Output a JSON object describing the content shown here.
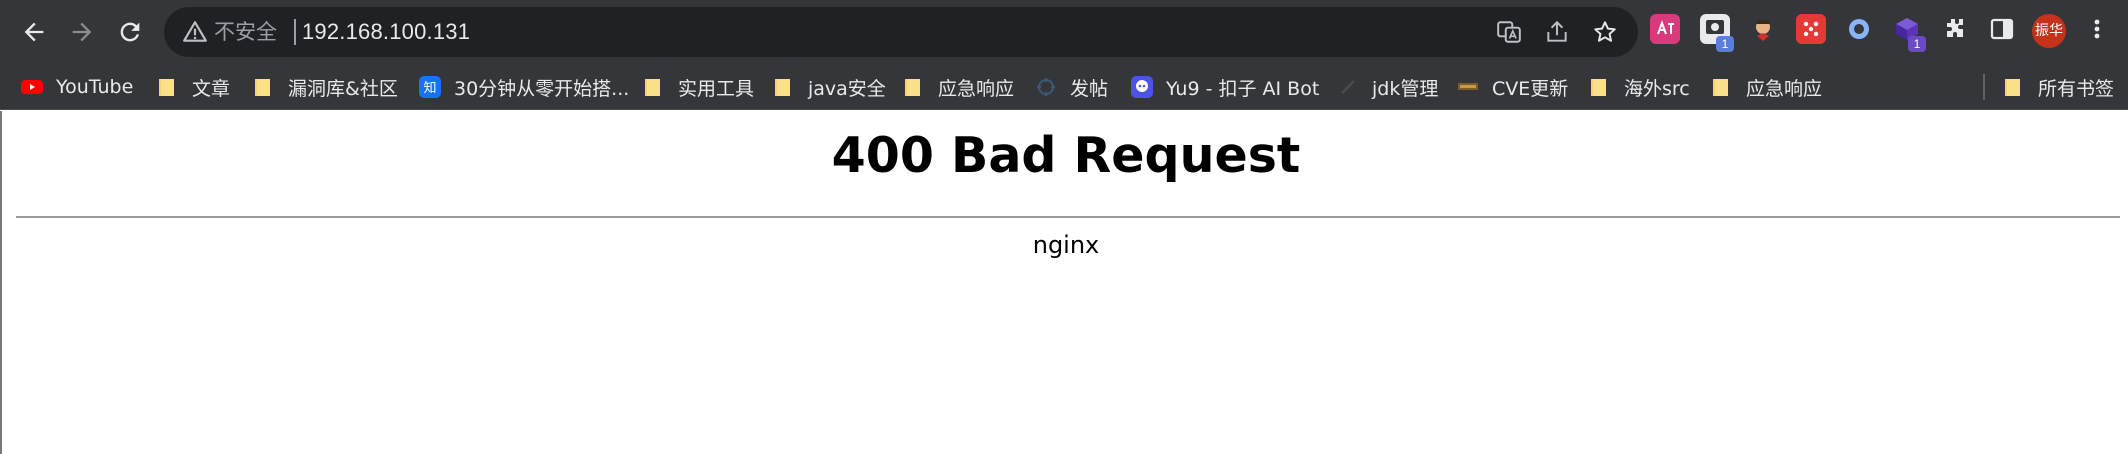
{
  "browser": {
    "security_label": "不安全",
    "url": "192.168.100.131"
  },
  "bookmarks": [
    {
      "label": "YouTube",
      "icon": "youtube-icon"
    },
    {
      "label": "文章",
      "icon": "folder-icon"
    },
    {
      "label": "漏洞库&社区",
      "icon": "folder-icon"
    },
    {
      "label": "30分钟从零开始搭...",
      "icon": "zhihu-icon"
    },
    {
      "label": "实用工具",
      "icon": "folder-icon"
    },
    {
      "label": "java安全",
      "icon": "folder-icon"
    },
    {
      "label": "应急响应",
      "icon": "folder-icon"
    },
    {
      "label": "发帖",
      "icon": "site-icon"
    },
    {
      "label": "Yu9 - 扣子 AI Bot",
      "icon": "bot-icon"
    },
    {
      "label": "jdk管理",
      "icon": "site-icon"
    },
    {
      "label": "CVE更新",
      "icon": "cve-icon"
    },
    {
      "label": "海外src",
      "icon": "folder-icon"
    },
    {
      "label": "应急响应",
      "icon": "folder-icon"
    }
  ],
  "all_bookmarks_label": "所有书签",
  "extensions": {
    "badge_1": "1",
    "badge_2": "1",
    "avatar_text": "振华"
  },
  "page": {
    "title": "400 Bad Request",
    "server": "nginx"
  }
}
